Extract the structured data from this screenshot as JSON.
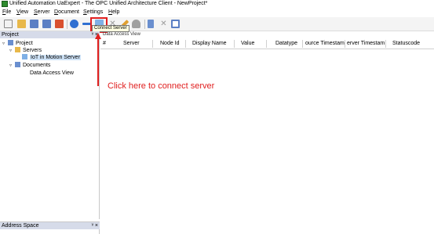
{
  "window": {
    "title": "Unified Automation UaExpert - The OPC Unified Architecture Client - NewProject*"
  },
  "menu": [
    {
      "label": "File",
      "mnemonic": "F",
      "rest": "ile"
    },
    {
      "label": "View",
      "mnemonic": "V",
      "rest": "iew"
    },
    {
      "label": "Server",
      "mnemonic": "S",
      "rest": "erver"
    },
    {
      "label": "Document",
      "mnemonic": "D",
      "rest": "ocument"
    },
    {
      "label": "Settings",
      "mnemonic": "S",
      "rest": "ettings"
    },
    {
      "label": "Help",
      "mnemonic": "H",
      "rest": "elp"
    }
  ],
  "toolbar": {
    "buttons": [
      {
        "name": "new-project-icon",
        "color": "#f2f2f2"
      },
      {
        "name": "open-project-icon",
        "color": "#e8b84a"
      },
      {
        "name": "save-project-icon",
        "color": "#5b7fc4"
      },
      {
        "name": "save-as-icon",
        "color": "#5b7fc4"
      },
      {
        "name": "preferences-icon",
        "color": "#d9502e"
      },
      {
        "name": "add-server-icon",
        "color": "#2f6fd1"
      },
      {
        "name": "remove-server-icon",
        "color": "#2f6fd1"
      },
      {
        "name": "connect-server-icon",
        "color": "#7fb0e6"
      },
      {
        "name": "disconnect-server-icon",
        "color": "#9a9a9a"
      },
      {
        "name": "pencil-icon",
        "color": "#e0a030"
      },
      {
        "name": "user-icon",
        "color": "#a0a0a0"
      },
      {
        "name": "document-icon",
        "color": "#6a8fcf"
      },
      {
        "name": "delete-document-icon",
        "color": "#9a9a9a"
      },
      {
        "name": "window-icon",
        "color": "#5b7fc4"
      }
    ],
    "tooltip": "Connect Server"
  },
  "project_panel": {
    "title": "Project",
    "buttons": "ᵛ ×",
    "tree": [
      {
        "label": "Project",
        "expander": "▿",
        "icon_color": "#6a8fcf",
        "level": 0
      },
      {
        "label": "Servers",
        "expander": "▿",
        "icon_color": "#e8b84a",
        "level": 1
      },
      {
        "label": "IoT in Motion Server",
        "expander": "",
        "icon_color": "#7fb0e6",
        "level": 2,
        "selected": true
      },
      {
        "label": "Documents",
        "expander": "▿",
        "icon_color": "#6a8fcf",
        "level": 1
      },
      {
        "label": "Data Access View",
        "expander": "",
        "icon_color": "",
        "level": 2
      }
    ]
  },
  "address_panel": {
    "title": "Address Space",
    "buttons": "ᵛ ×"
  },
  "data_access_view": {
    "tab_label": "Data Access View",
    "columns": [
      "#",
      "Server",
      "Node Id",
      "Display Name",
      "Value",
      "Datatype",
      "ource Timestam",
      "erver Timestam",
      "Statuscode"
    ]
  },
  "annotation": {
    "text": "Click here to connect server",
    "color": "#e02020"
  }
}
